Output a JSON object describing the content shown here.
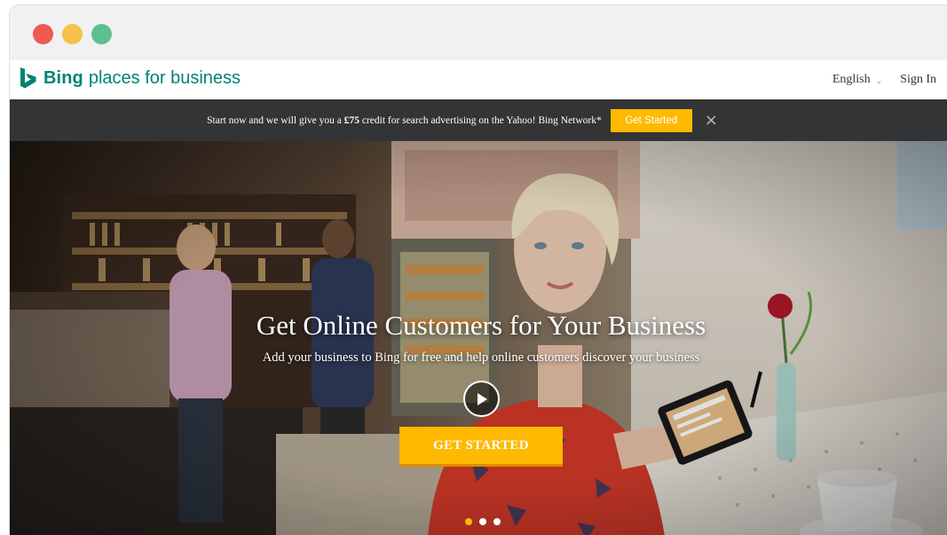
{
  "window": {
    "controls": {
      "close_color": "#ee5a52",
      "minimize_color": "#f7c04a",
      "zoom_color": "#5dbf8e"
    }
  },
  "header": {
    "logo_icon": "bing-b-logo",
    "logo_bing": "Bing",
    "logo_rest": "places for business",
    "language": "English",
    "sign_in": "Sign In",
    "brand_color": "#008373"
  },
  "promo": {
    "text_before": "Start now and we will give you a ",
    "amount": "£75",
    "text_after": " credit for search advertising on the Yahoo! Bing Network*",
    "button": "Get Started",
    "close": "×"
  },
  "hero": {
    "title": "Get Online Customers for Your Business",
    "subtitle": "Add your business to Bing for free and help online customers discover your business",
    "cta": "GET STARTED",
    "accent_color": "#ffb900",
    "slides_total": 3,
    "slide_active": 1
  }
}
